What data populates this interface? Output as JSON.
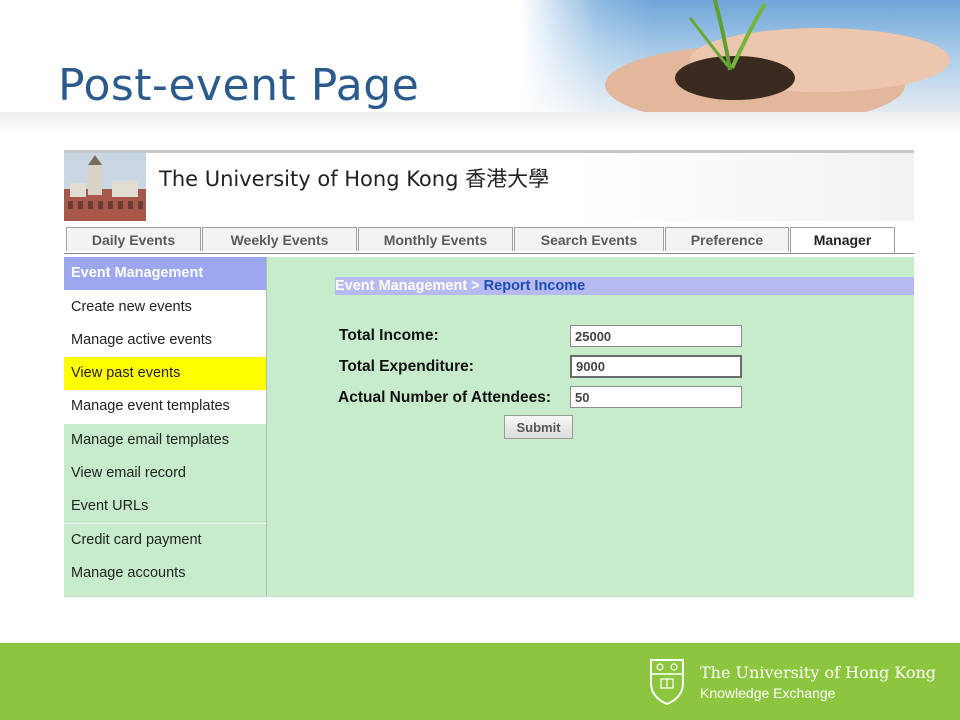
{
  "slide": {
    "title": "Post-event Page"
  },
  "app": {
    "university_name": "The University of Hong Kong 香港大學"
  },
  "tabs": [
    {
      "label": "Daily Events"
    },
    {
      "label": "Weekly Events"
    },
    {
      "label": "Monthly Events"
    },
    {
      "label": "Search Events"
    },
    {
      "label": "Preference"
    },
    {
      "label": "Manager",
      "active": true
    }
  ],
  "sidebar": {
    "header": "Event Management",
    "items": [
      {
        "label": "Create new events"
      },
      {
        "label": "Manage active events"
      },
      {
        "label": "View past events",
        "highlighted": true
      },
      {
        "label": "Manage event templates"
      },
      {
        "label": "Manage email templates"
      },
      {
        "label": "View email record"
      },
      {
        "label": "Event URLs"
      },
      {
        "label": "Credit card payment"
      },
      {
        "label": "Manage accounts"
      }
    ]
  },
  "breadcrumb": {
    "parent": "Event Management > ",
    "current": "Report Income"
  },
  "form": {
    "total_income": {
      "label": "Total Income:",
      "value": "25000"
    },
    "total_expenditure": {
      "label": "Total Expenditure:",
      "value": "9000"
    },
    "attendees": {
      "label": "Actual Number of Attendees:",
      "value": "50"
    },
    "submit_label": "Submit"
  },
  "footer": {
    "line1": "The University of Hong Kong",
    "line2": "Knowledge Exchange"
  },
  "colors": {
    "title_blue": "#2b5a8c",
    "content_green": "#c7eccb",
    "sidebar_header": "#9da7f0",
    "highlight_yellow": "#ffff00",
    "footer_green": "#8cc63e",
    "crumb_link": "#1d4fb3"
  },
  "icons": {
    "building": "building-photo-icon",
    "crest": "university-crest-icon"
  }
}
